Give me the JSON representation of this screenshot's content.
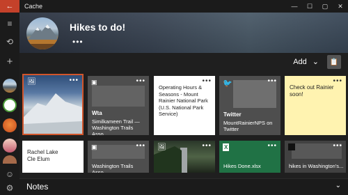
{
  "window": {
    "title": "Cache",
    "back_glyph": "←",
    "controls": [
      "—",
      "☐",
      "▢",
      "✕"
    ]
  },
  "rail": {
    "menu_icon": "≡",
    "history_icon": "⟲",
    "add_icon": "+",
    "smile_icon": "☺",
    "settings_icon": "⚙"
  },
  "header": {
    "title": "Hikes to do!",
    "more": "•••"
  },
  "toolbar": {
    "add_label": "Add",
    "add_chevron": "⌄",
    "paste_icon": "📋"
  },
  "tiles": [
    {
      "type": "image",
      "more": "•••"
    },
    {
      "type": "web",
      "source": "Wta",
      "text": "Similkameen Trail — Washington Trails Asso...",
      "more": "•••"
    },
    {
      "type": "note",
      "text": "Operating Hours & Seasons - Mount Rainier National Park (U.S. National Park Service)",
      "more": "•••"
    },
    {
      "type": "twitter",
      "source": "Twitter",
      "text": "MountRainierNPS on Twitter",
      "more": "•••"
    },
    {
      "type": "sticky",
      "text": "Check out Rainier soon!",
      "more": "•••"
    },
    {
      "type": "note",
      "text": "Rachel Lake\nCle Elum",
      "more": "•••"
    },
    {
      "type": "web",
      "text": "Washington Trails Asso...",
      "more": "•••"
    },
    {
      "type": "image",
      "more": "•••"
    },
    {
      "type": "excel",
      "text": "Hikes Done.xlsx",
      "more": "•••"
    },
    {
      "type": "web",
      "text": "hikes in Washington's...",
      "more": "•••"
    }
  ],
  "notes": {
    "label": "Notes",
    "chevron": "⌄"
  },
  "colors": {
    "accent": "#c4412a",
    "selection": "#d2552b",
    "sticky": "#fff3b0",
    "excel": "#207245"
  }
}
